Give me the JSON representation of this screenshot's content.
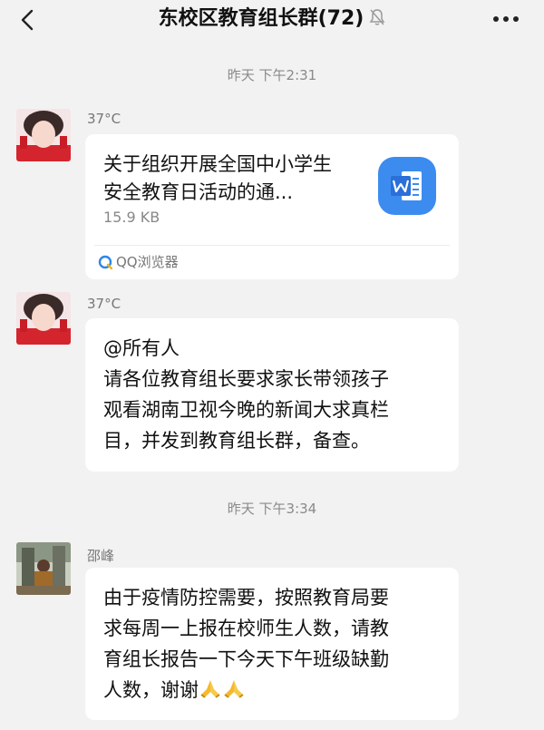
{
  "header": {
    "title": "东校区教育组长群(72)",
    "back_icon": "chevron-left-icon",
    "muted_icon": "bell-muted-icon",
    "more_icon": "more-horizontal-icon"
  },
  "messages": [
    {
      "timestamp": "昨天 下午2:31",
      "sender": "37°C",
      "type": "file",
      "file": {
        "name": "关于组织开展全国中小学生安全教育日活动的通...",
        "size": "15.9 KB",
        "icon": "word-document-icon",
        "source_icon": "qq-browser-icon",
        "source": "QQ浏览器"
      }
    },
    {
      "sender": "37°C",
      "type": "text",
      "lines": [
        "@所有人",
        "请各位教育组长要求家长带领孩子",
        "观看湖南卫视今晚的新闻大求真栏",
        "目，并发到教育组长群，备查。"
      ]
    },
    {
      "timestamp": "昨天 下午3:34",
      "sender": "邵峰",
      "type": "text",
      "lines": [
        "由于疫情防控需要，按照教育局要",
        "求每周一上报在校师生人数，请教",
        "育组长报告一下今天下午班级缺勤",
        "人数，谢谢"
      ],
      "emoji": [
        "praying-hands-icon",
        "praying-hands-icon"
      ]
    }
  ],
  "colors": {
    "background": "#f2f2f2",
    "bubble": "#ffffff",
    "word_blue": "#3c8cf0"
  }
}
